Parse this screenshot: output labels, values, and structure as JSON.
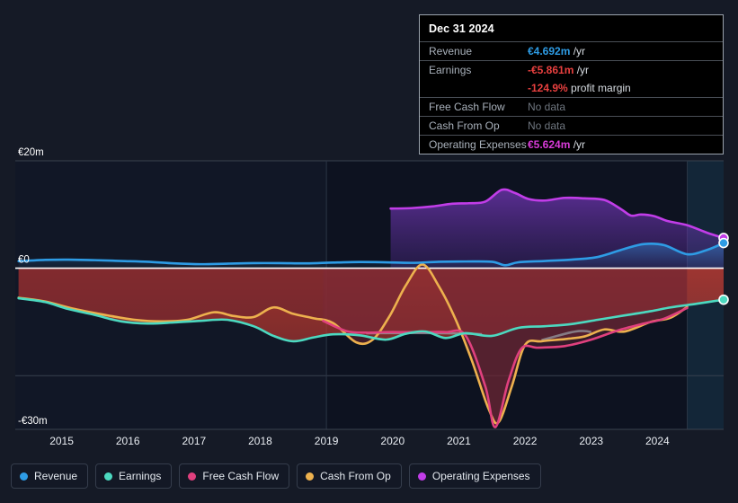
{
  "tooltip": {
    "date": "Dec 31 2024",
    "rows": [
      {
        "key": "Revenue",
        "value": "€4.692m",
        "unit": "/yr",
        "state": "revenue"
      },
      {
        "key": "Earnings",
        "value": "-€5.861m",
        "unit": "/yr",
        "state": "negative"
      },
      {
        "key": "",
        "value": "-124.9%",
        "unit": "profit margin",
        "state": "negative"
      },
      {
        "key": "Free Cash Flow",
        "value": "No data",
        "unit": "",
        "state": "nodata"
      },
      {
        "key": "Cash From Op",
        "value": "No data",
        "unit": "",
        "state": "nodata"
      },
      {
        "key": "Operating Expenses",
        "value": "€5.624m",
        "unit": "/yr",
        "state": "opex"
      }
    ]
  },
  "legend": [
    {
      "label": "Revenue",
      "color": "#2e9ce5"
    },
    {
      "label": "Earnings",
      "color": "#4cd9c0"
    },
    {
      "label": "Free Cash Flow",
      "color": "#e0407e"
    },
    {
      "label": "Cash From Op",
      "color": "#edb14e"
    },
    {
      "label": "Operating Expenses",
      "color": "#c13de8"
    }
  ],
  "chart_data": {
    "type": "area",
    "title": "",
    "xlabel": "",
    "ylabel": "",
    "currency": "EUR",
    "units": "millions",
    "grid": true,
    "legend_position": "bottom",
    "ylim": [
      -30,
      20
    ],
    "ytick_labels": [
      "€20m",
      "€0",
      "-€30m"
    ],
    "ytick_values": [
      20,
      0,
      -30
    ],
    "xlim": [
      2014.3,
      2025.0
    ],
    "xtick_labels": [
      "2015",
      "2016",
      "2017",
      "2018",
      "2019",
      "2020",
      "2021",
      "2022",
      "2023",
      "2024"
    ],
    "xtick_values": [
      2015,
      2016,
      2017,
      2018,
      2019,
      2020,
      2021,
      2022,
      2023,
      2024
    ],
    "forecast_band": {
      "start": 2024.45,
      "end": 2025.0,
      "label": ""
    },
    "shaded_band": {
      "start": 2019.0,
      "end": 2024.45
    },
    "series": [
      {
        "name": "Revenue",
        "color": "#2e9ce5",
        "x": [
          2014.35,
          2014.75,
          2015.1,
          2015.5,
          2015.9,
          2016.3,
          2016.7,
          2017.1,
          2017.5,
          2017.9,
          2018.3,
          2018.7,
          2019.1,
          2019.5,
          2019.9,
          2020.3,
          2020.7,
          2021.1,
          2021.5,
          2021.7,
          2021.9,
          2022.3,
          2022.7,
          2023.1,
          2023.5,
          2023.8,
          2024.1,
          2024.45,
          2024.75,
          2025.0
        ],
        "values": [
          1.3,
          1.55,
          1.6,
          1.5,
          1.35,
          1.2,
          0.9,
          0.75,
          0.85,
          0.95,
          0.95,
          0.9,
          1.05,
          1.15,
          1.1,
          1.0,
          1.2,
          1.25,
          1.2,
          0.55,
          1.1,
          1.35,
          1.6,
          2.1,
          3.6,
          4.5,
          4.3,
          2.6,
          3.4,
          4.692
        ]
      },
      {
        "name": "Earnings",
        "color": "#4cd9c0",
        "x": [
          2014.35,
          2014.75,
          2015.1,
          2015.5,
          2015.9,
          2016.3,
          2016.7,
          2017.1,
          2017.5,
          2017.9,
          2018.2,
          2018.5,
          2018.8,
          2019.1,
          2019.5,
          2019.9,
          2020.2,
          2020.5,
          2020.8,
          2021.1,
          2021.5,
          2021.9,
          2022.3,
          2022.7,
          2023.1,
          2023.5,
          2023.9,
          2024.2,
          2024.6,
          2025.0
        ],
        "values": [
          -5.6,
          -6.3,
          -7.6,
          -8.7,
          -9.9,
          -10.3,
          -10.1,
          -9.8,
          -9.6,
          -10.8,
          -12.6,
          -13.6,
          -12.9,
          -12.3,
          -12.5,
          -13.3,
          -12.2,
          -11.8,
          -13.0,
          -12.1,
          -12.6,
          -11.1,
          -10.8,
          -10.4,
          -9.6,
          -8.8,
          -8.0,
          -7.3,
          -6.6,
          -5.861
        ]
      },
      {
        "name": "Free Cash Flow",
        "color": "#e0407e",
        "x": [
          2018.95,
          2019.3,
          2019.6,
          2019.9,
          2020.2,
          2020.5,
          2020.8,
          2021.1,
          2021.4,
          2021.55,
          2021.75,
          2021.95,
          2022.2,
          2022.6,
          2023.0,
          2023.4,
          2023.8,
          2024.1,
          2024.45
        ],
        "values": [
          -9.8,
          -11.7,
          -12.0,
          -11.9,
          -11.9,
          -11.9,
          -11.9,
          -12.5,
          -22.0,
          -29.6,
          -21.0,
          -14.9,
          -14.8,
          -14.5,
          -13.3,
          -11.6,
          -10.3,
          -9.4,
          -7.4
        ]
      },
      {
        "name": "Cash From Op",
        "color": "#edb14e",
        "x": [
          2014.35,
          2014.75,
          2015.2,
          2015.7,
          2016.1,
          2016.5,
          2016.9,
          2017.3,
          2017.6,
          2017.9,
          2018.2,
          2018.5,
          2018.8,
          2019.1,
          2019.45,
          2019.7,
          2019.95,
          2020.2,
          2020.45,
          2020.7,
          2020.95,
          2021.2,
          2021.45,
          2021.6,
          2021.8,
          2022.0,
          2022.25,
          2022.6,
          2022.9,
          2023.2,
          2023.5,
          2023.9,
          2024.2,
          2024.45
        ],
        "values": [
          -5.5,
          -6.2,
          -7.6,
          -8.8,
          -9.6,
          -9.9,
          -9.6,
          -8.2,
          -8.9,
          -9.1,
          -7.3,
          -8.5,
          -9.3,
          -10.2,
          -13.8,
          -13.3,
          -9.0,
          -3.2,
          0.7,
          -3.4,
          -9.5,
          -17.3,
          -26.2,
          -28.7,
          -22.0,
          -14.3,
          -13.6,
          -13.2,
          -12.7,
          -11.4,
          -11.8,
          -10.0,
          -9.2,
          -7.2
        ]
      },
      {
        "name": "Operating Expenses",
        "color": "#c13de8",
        "x": [
          2019.97,
          2020.3,
          2020.6,
          2020.9,
          2021.15,
          2021.4,
          2021.65,
          2021.85,
          2022.05,
          2022.3,
          2022.6,
          2022.9,
          2023.2,
          2023.45,
          2023.6,
          2023.75,
          2023.95,
          2024.15,
          2024.45,
          2024.75,
          2025.0
        ],
        "values": [
          11.1,
          11.2,
          11.5,
          12.0,
          12.1,
          12.4,
          14.6,
          14.0,
          12.9,
          12.6,
          13.1,
          13.0,
          12.7,
          11.0,
          9.8,
          10.0,
          9.7,
          8.8,
          8.0,
          6.6,
          5.624
        ]
      }
    ],
    "highlight_point": {
      "x": 2025.0,
      "date": "Dec 31 2024"
    }
  }
}
